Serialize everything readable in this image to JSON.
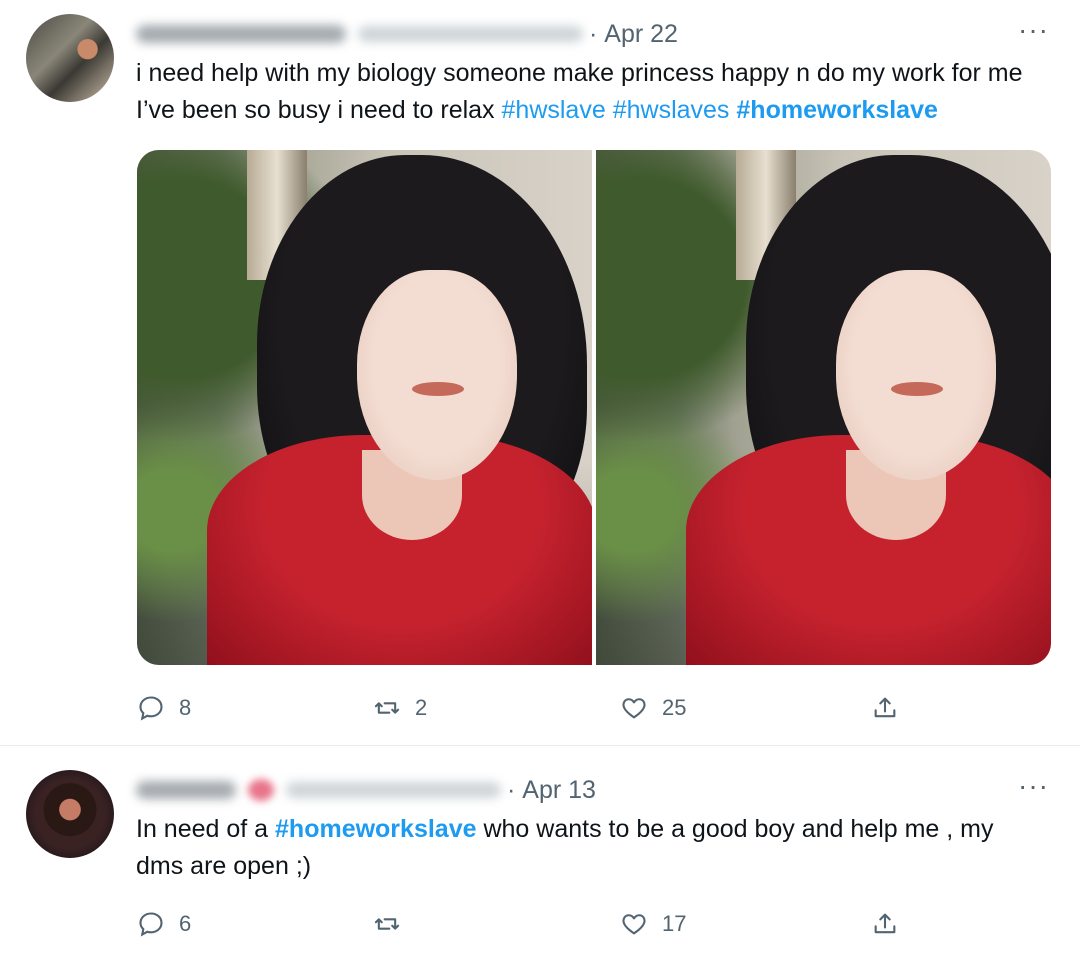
{
  "tweets": [
    {
      "date": "Apr 22",
      "text_plain": "i need help with my biology someone make princess happy n do my work for me I’ve been so busy i need to relax ",
      "hashtags": [
        "#hwslave",
        "#hwslaves",
        "#homeworkslave"
      ],
      "more_icon": "···",
      "media_count": 2,
      "actions": {
        "replies": "8",
        "retweets": "2",
        "likes": "25"
      }
    },
    {
      "date": "Apr 13",
      "text_before": "In need of a ",
      "hashtag": "#homeworkslave",
      "text_after": " who wants to be a good boy and help me , my dms are open ;)",
      "more_icon": "···",
      "actions": {
        "replies": "6",
        "retweets": "",
        "likes": "17"
      }
    }
  ],
  "icons": {
    "reply": "reply-bubble-icon",
    "retweet": "retweet-arrows-icon",
    "like": "heart-icon",
    "share": "share-upload-icon"
  },
  "colors": {
    "link": "#1d9bf0",
    "text": "#0f1419",
    "secondary": "#536471",
    "divider": "#e6ecf0"
  }
}
